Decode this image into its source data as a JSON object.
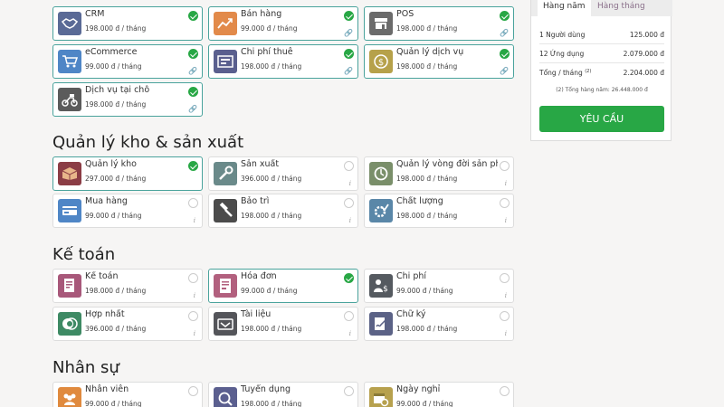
{
  "colors": {
    "accent": "#28a745",
    "selected_border": "#4aa39c",
    "link": "#5a7fa4"
  },
  "sections": {
    "inventory": "Quản lý kho & sản xuất",
    "accounting": "Kế toán",
    "hr": "Nhân sự"
  },
  "apps": {
    "crm": {
      "name": "CRM",
      "price": "198.000 đ / tháng",
      "icon": "handshake-icon"
    },
    "sales": {
      "name": "Bán hàng",
      "price": "99.000 đ / tháng",
      "icon": "chart-up-icon"
    },
    "pos": {
      "name": "POS",
      "price": "198.000 đ / tháng",
      "icon": "store-icon"
    },
    "ecommerce": {
      "name": "eCommerce",
      "price": "99.000 đ / tháng",
      "icon": "cart-icon"
    },
    "rental": {
      "name": "Chi phí thuê",
      "price": "198.000 đ / tháng",
      "icon": "rental-screen-icon"
    },
    "services": {
      "name": "Quản lý dịch vụ",
      "price": "198.000 đ / tháng",
      "icon": "dollar-coin-icon"
    },
    "onsite": {
      "name": "Dịch vụ tại chỗ",
      "price": "198.000 đ / tháng",
      "icon": "scooter-icon"
    },
    "inventory": {
      "name": "Quản lý kho",
      "price": "297.000 đ / tháng",
      "icon": "box-icon"
    },
    "manufacturing": {
      "name": "Sản xuất",
      "price": "396.000 đ / tháng",
      "icon": "wrench-icon"
    },
    "plm": {
      "name": "Quản lý vòng đời sản phẩ...",
      "price": "198.000 đ / tháng",
      "icon": "cycle-icon"
    },
    "purchase": {
      "name": "Mua hàng",
      "price": "99.000 đ / tháng",
      "icon": "credit-card-icon"
    },
    "maintenance": {
      "name": "Bảo trì",
      "price": "198.000 đ / tháng",
      "icon": "hammer-icon"
    },
    "quality": {
      "name": "Chất lượng",
      "price": "198.000 đ / tháng",
      "icon": "gear-check-icon"
    },
    "accounting": {
      "name": "Kế toán",
      "price": "198.000 đ / tháng",
      "icon": "ledger-icon"
    },
    "invoicing": {
      "name": "Hóa đơn",
      "price": "99.000 đ / tháng",
      "icon": "invoice-icon"
    },
    "expenses": {
      "name": "Chi phí",
      "price": "99.000 đ / tháng",
      "icon": "person-dollar-icon"
    },
    "consolidation": {
      "name": "Hợp nhất",
      "price": "396.000 đ / tháng",
      "icon": "merge-circles-icon"
    },
    "documents": {
      "name": "Tài liệu",
      "price": "198.000 đ / tháng",
      "icon": "wallet-icon"
    },
    "sign": {
      "name": "Chữ ký",
      "price": "198.000 đ / tháng",
      "icon": "signature-icon"
    },
    "employees": {
      "name": "Nhân viên",
      "price": "99.000 đ / tháng",
      "icon": "people-icon"
    },
    "recruitment": {
      "name": "Tuyển dụng",
      "price": "198.000 đ / tháng",
      "icon": "magnifier-person-icon"
    },
    "timeoff": {
      "name": "Ngày nghỉ",
      "price": "99.000 đ / tháng",
      "icon": "calendar-gear-icon"
    }
  },
  "summary": {
    "tab_yearly": "Hàng năm",
    "tab_monthly": "Hàng tháng",
    "users_label": "1 Người dùng",
    "users_value": "125.000 đ",
    "apps_label": "12 Ứng dụng",
    "apps_value": "2.079.000 đ",
    "total_label": "Tổng / tháng",
    "total_marker": "(2)",
    "total_value": "2.204.000 đ",
    "yearly_note": "(2) Tổng hàng năm: 26.448.000 đ",
    "request_button": "YÊU CẦU"
  }
}
